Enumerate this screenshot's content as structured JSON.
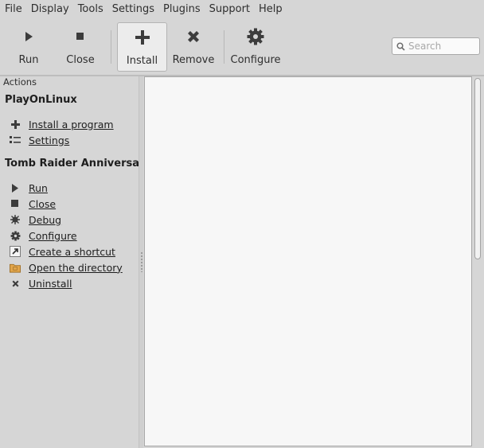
{
  "menu": [
    "File",
    "Display",
    "Tools",
    "Settings",
    "Plugins",
    "Support",
    "Help"
  ],
  "toolbar": {
    "run_label": "Run",
    "close_label": "Close",
    "install_label": "Install",
    "remove_label": "Remove",
    "configure_label": "Configure"
  },
  "search": {
    "placeholder": "Search",
    "value": ""
  },
  "sidebar": {
    "header": "Actions",
    "groups": [
      {
        "title": "PlayOnLinux",
        "items": [
          {
            "label": "Install a program",
            "icon": "plus-icon"
          },
          {
            "label": "Settings",
            "icon": "settings-list-icon"
          }
        ]
      },
      {
        "title": "Tomb Raider Anniversary",
        "items": [
          {
            "label": "Run",
            "icon": "play-icon"
          },
          {
            "label": "Close",
            "icon": "stop-icon"
          },
          {
            "label": "Debug",
            "icon": "bug-icon"
          },
          {
            "label": "Configure",
            "icon": "gear-icon"
          },
          {
            "label": "Create a shortcut",
            "icon": "shortcut-icon"
          },
          {
            "label": "Open the directory",
            "icon": "folder-icon"
          },
          {
            "label": "Uninstall",
            "icon": "x-icon"
          }
        ]
      }
    ]
  },
  "colors": {
    "background": "#d6d6d6",
    "panel": "#f7f7f7",
    "icon": "#3c3c3c",
    "folder": "#e2a54a"
  }
}
